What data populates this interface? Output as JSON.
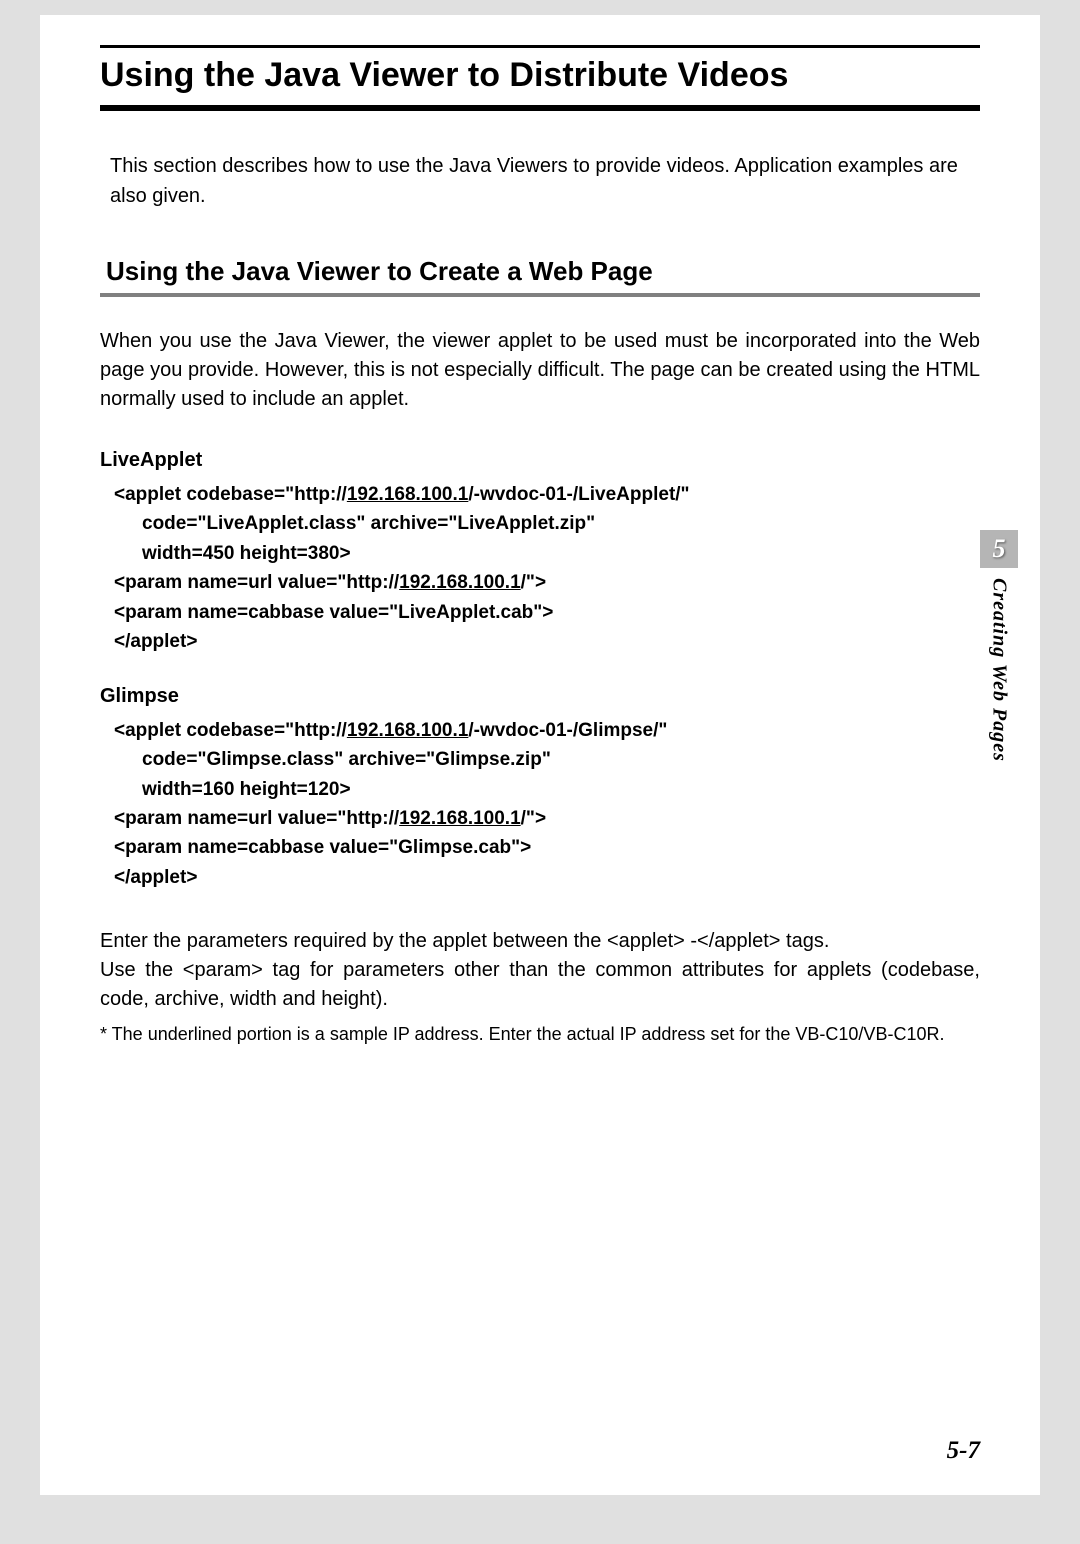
{
  "main_title": "Using the Java Viewer to Distribute Videos",
  "intro": "This section describes how to use the Java Viewers to provide videos. Application examples are also given.",
  "section_title": "Using the Java Viewer to Create a Web Page",
  "section_intro": "When you use the Java Viewer, the viewer applet to be used must be incorporated into the Web page you provide. However, this is not especially difficult. The page can be created using the HTML normally used to include an applet.",
  "code1": {
    "label": "LiveApplet",
    "line1_a": "<applet codebase=\"http://",
    "line1_ip": "192.168.100.1",
    "line1_b": "/-wvdoc-01-/LiveApplet/\"",
    "line2": "code=\"LiveApplet.class\" archive=\"LiveApplet.zip\"",
    "line3": "width=450 height=380>",
    "line4_a": " <param name=url     value=\"http://",
    "line4_ip": "192.168.100.1",
    "line4_b": "/\">",
    "line5": " <param name=cabbase value=\"LiveApplet.cab\">",
    "line6": " </applet>"
  },
  "code2": {
    "label": "Glimpse",
    "line1_a": "<applet codebase=\"http://",
    "line1_ip": "192.168.100.1",
    "line1_b": "/-wvdoc-01-/Glimpse/\"",
    "line2": "code=\"Glimpse.class\" archive=\"Glimpse.zip\"",
    "line3": "width=160 height=120>",
    "line4_a": " <param name=url     value=\"http://",
    "line4_ip": "192.168.100.1",
    "line4_b": "/\">",
    "line5": " <param name=cabbase value=\"Glimpse.cab\">",
    "line6": " </applet>"
  },
  "para2_line1": "Enter the parameters required by the applet between the <applet> -</applet> tags.",
  "para2_line2": "Use the <param> tag for parameters other than the common attributes for applets (codebase, code, archive, width and height).",
  "footnote": "* The underlined portion is a sample IP address. Enter the actual IP address set for the VB-C10/VB-C10R.",
  "sidetab": {
    "number": "5",
    "text": "Creating Web Pages"
  },
  "page_number": "5-7"
}
